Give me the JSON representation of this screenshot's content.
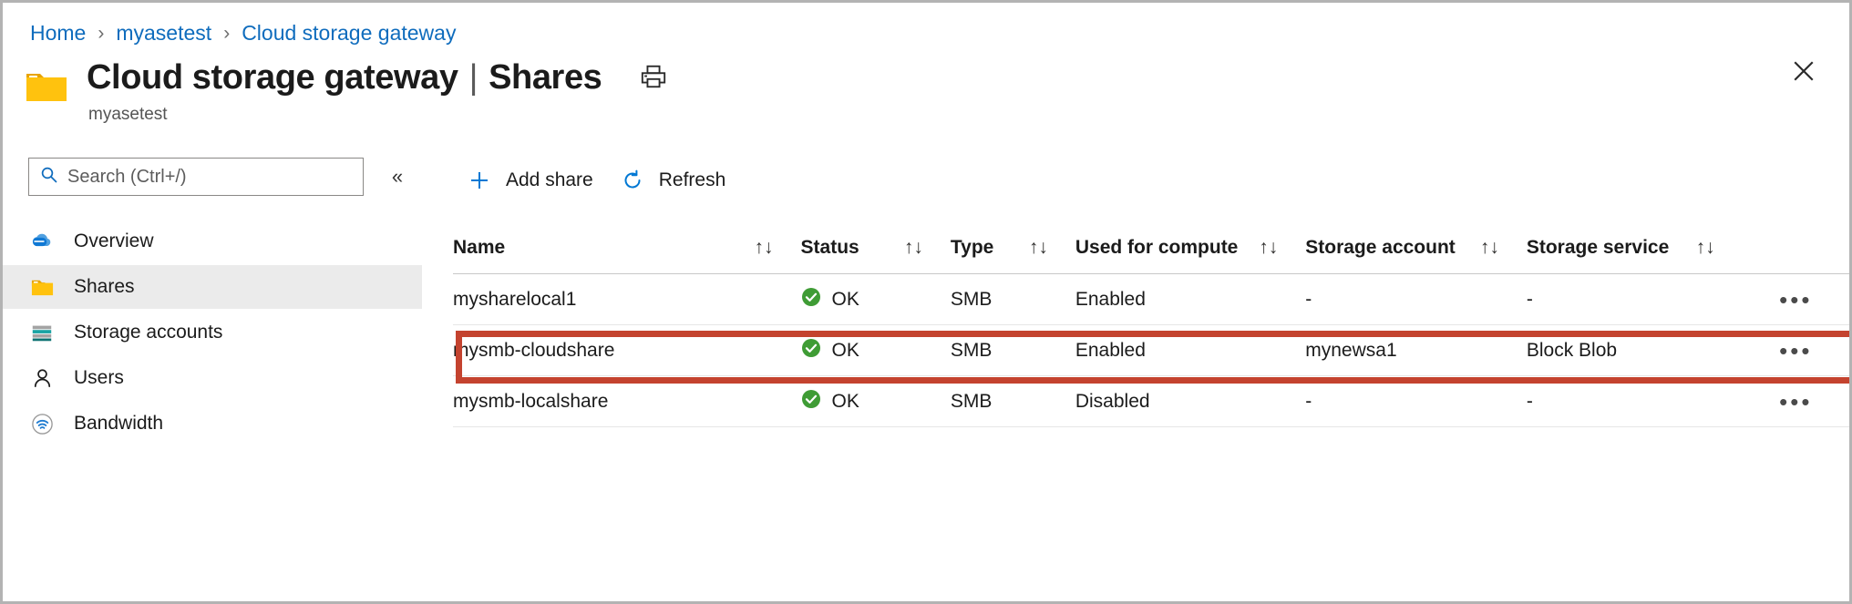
{
  "breadcrumb": {
    "items": [
      "Home",
      "myasetest",
      "Cloud storage gateway"
    ],
    "separator": "›"
  },
  "header": {
    "title": "Cloud storage gateway",
    "separator": "|",
    "section": "Shares",
    "subtitle": "myasetest",
    "resource_icon": "folder-icon",
    "print_icon": "printer-icon",
    "close_icon": "close-icon"
  },
  "sidebar": {
    "search": {
      "placeholder": "Search (Ctrl+/)",
      "value": "",
      "icon": "search-icon"
    },
    "collapse_icon": "chevron-double-left-icon",
    "collapse_label": "«",
    "items": [
      {
        "label": "Overview",
        "icon": "cloud-icon",
        "selected": false
      },
      {
        "label": "Shares",
        "icon": "folder-icon",
        "selected": true
      },
      {
        "label": "Storage accounts",
        "icon": "storage-account-icon",
        "selected": false
      },
      {
        "label": "Users",
        "icon": "person-icon",
        "selected": false
      },
      {
        "label": "Bandwidth",
        "icon": "bandwidth-icon",
        "selected": false
      }
    ]
  },
  "toolbar": {
    "buttons": [
      {
        "label": "Add share",
        "icon": "plus-icon"
      },
      {
        "label": "Refresh",
        "icon": "refresh-icon"
      }
    ]
  },
  "table": {
    "columns": [
      {
        "label": "Name",
        "sortable": true
      },
      {
        "label": "Status",
        "sortable": true
      },
      {
        "label": "Type",
        "sortable": true
      },
      {
        "label": "Used for compute",
        "sortable": true
      },
      {
        "label": "Storage account",
        "sortable": true
      },
      {
        "label": "Storage service",
        "sortable": true
      }
    ],
    "sort_glyph": "↑↓",
    "row_menu_glyph": "•••",
    "rows": [
      {
        "name": "mysharelocal1",
        "status": "OK",
        "status_icon": "check-circle-icon",
        "type": "SMB",
        "used_for_compute": "Enabled",
        "storage_account": "-",
        "storage_service": "-",
        "highlighted": false
      },
      {
        "name": "mysmb-cloudshare",
        "status": "OK",
        "status_icon": "check-circle-icon",
        "type": "SMB",
        "used_for_compute": "Enabled",
        "storage_account": "mynewsa1",
        "storage_service": "Block Blob",
        "highlighted": true
      },
      {
        "name": "mysmb-localshare",
        "status": "OK",
        "status_icon": "check-circle-icon",
        "type": "SMB",
        "used_for_compute": "Disabled",
        "storage_account": "-",
        "storage_service": "-",
        "highlighted": false
      }
    ]
  },
  "colors": {
    "link": "#0f6cbd",
    "accent": "#0078d4",
    "status_ok": "#3f9c35",
    "highlight_box": "#c4432f",
    "folder": "#ffc20e",
    "selected_row_bg": "#ebebeb"
  }
}
